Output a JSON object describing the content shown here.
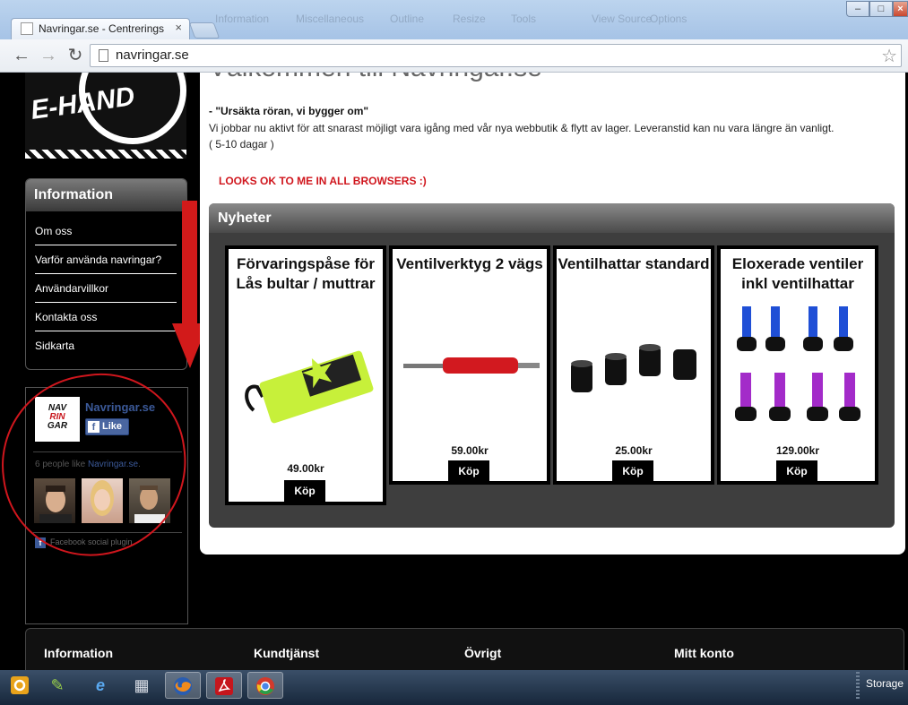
{
  "browser": {
    "tab_title": "Navringar.se - Centrerings",
    "url": "navringar.se",
    "bookmark_ghosts": [
      "Information",
      "Miscellaneous",
      "Outline",
      "Resize",
      "Tools",
      "View Source",
      "Options"
    ]
  },
  "sidebar": {
    "info_heading": "Information",
    "links": [
      {
        "label": "Om oss"
      },
      {
        "label": "Varför använda navringar?"
      },
      {
        "label": "Användarvillkor"
      },
      {
        "label": "Kontakta oss"
      },
      {
        "label": "Sidkarta"
      }
    ]
  },
  "facebook": {
    "page_name": "Navringar.se",
    "like_label": "Like",
    "likes_text": "6 people like",
    "likes_link": "Navringar.se",
    "likes_suffix": ".",
    "plugin_text": "Facebook social plugin",
    "logo_text_top": "NAV",
    "logo_text_mid": "RIN",
    "logo_text_bot": "GAR"
  },
  "logo": {
    "text": "E-HAND"
  },
  "content": {
    "welcome": "Välkommen till Navringar.se",
    "announcement_title": "- \"Ursäkta röran, vi bygger om\"",
    "announcement_line1": "Vi jobbar nu aktivt för att snarast möjligt vara igång med vår nya webbutik & flytt av lager. Leveranstid kan nu vara längre än vanligt.",
    "announcement_line2": "( 5-10 dagar )",
    "looks_ok": "LOOKS OK TO ME IN ALL BROWSERS :)"
  },
  "news": {
    "heading": "Nyheter",
    "buy_label": "Köp",
    "products": [
      {
        "name": "Förvaringspåse för Lås bultar / muttrar",
        "price": "49.00kr"
      },
      {
        "name": "Ventilverktyg 2 vägs",
        "price": "59.00kr"
      },
      {
        "name": "Ventilhattar standard",
        "price": "25.00kr"
      },
      {
        "name": "Eloxerade ventiler inkl ventilhattar",
        "price": "129.00kr"
      }
    ]
  },
  "footer": {
    "headings": [
      "Information",
      "Kundtjänst",
      "Övrigt",
      "Mitt konto"
    ]
  },
  "taskbar": {
    "tray_label": "Storage"
  },
  "colors": {
    "accent_red": "#d0161d",
    "facebook_blue": "#3b5998",
    "page_bg": "#000000"
  }
}
